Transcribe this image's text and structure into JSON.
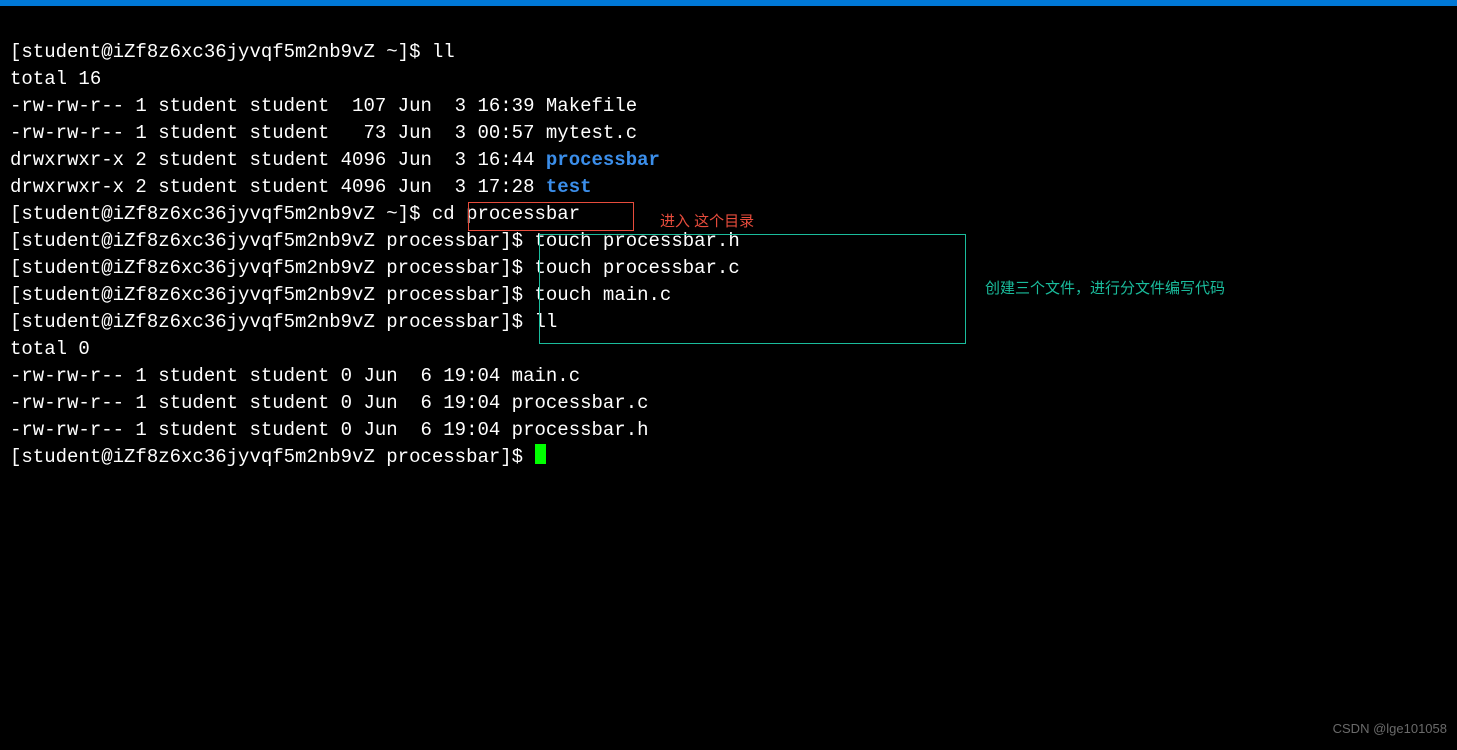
{
  "prompt_home": "[student@iZf8z6xc36jyvqf5m2nb9vZ ~]$ ",
  "prompt_dir": "[student@iZf8z6xc36jyvqf5m2nb9vZ processbar]$ ",
  "cmd_ll": "ll",
  "out_total16": "total 16",
  "ls1_line1": "-rw-rw-r-- 1 student student  107 Jun  3 16:39 Makefile",
  "ls1_line2": "-rw-rw-r-- 1 student student   73 Jun  3 00:57 mytest.c",
  "ls1_line3_pre": "drwxrwxr-x 2 student student 4096 Jun  3 16:44 ",
  "ls1_line3_dir": "processbar",
  "ls1_line4_pre": "drwxrwxr-x 2 student student 4096 Jun  3 17:28 ",
  "ls1_line4_dir": "test",
  "cmd_cd": "cd processbar",
  "cmd_touch1": "touch processbar.h",
  "cmd_touch2": "touch processbar.c",
  "cmd_touch3": "touch main.c",
  "out_total0": "total 0",
  "ls2_line1": "-rw-rw-r-- 1 student student 0 Jun  6 19:04 main.c",
  "ls2_line2": "-rw-rw-r-- 1 student student 0 Jun  6 19:04 processbar.c",
  "ls2_line3": "-rw-rw-r-- 1 student student 0 Jun  6 19:04 processbar.h",
  "anno_red": "进入 这个目录",
  "anno_cyan": "创建三个文件，进行分文件编写代码",
  "watermark": "CSDN @lge101058"
}
